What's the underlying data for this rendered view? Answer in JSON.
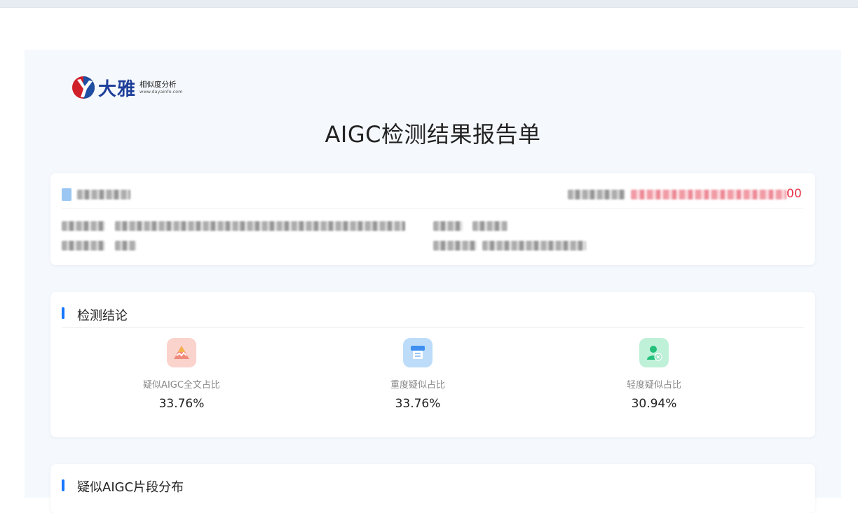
{
  "logo": {
    "name": "大雅",
    "subtitle": "相似度分析",
    "url": "www.dayainfo.com"
  },
  "report_title": "AIGC检测结果报告单",
  "info": {
    "report_no_suffix": "00"
  },
  "result_section": {
    "title": "检测结论",
    "stats": [
      {
        "label": "疑似AIGC全文占比",
        "value": "33.76%",
        "icon": "warning-triangle-icon",
        "color": "#fbd3cd"
      },
      {
        "label": "重度疑似占比",
        "value": "33.76%",
        "icon": "document-scan-icon",
        "color": "#bddcf9"
      },
      {
        "label": "轻度疑似占比",
        "value": "30.94%",
        "icon": "user-check-icon",
        "color": "#bff0d8"
      }
    ]
  },
  "distribution_section": {
    "title": "疑似AIGC片段分布"
  }
}
